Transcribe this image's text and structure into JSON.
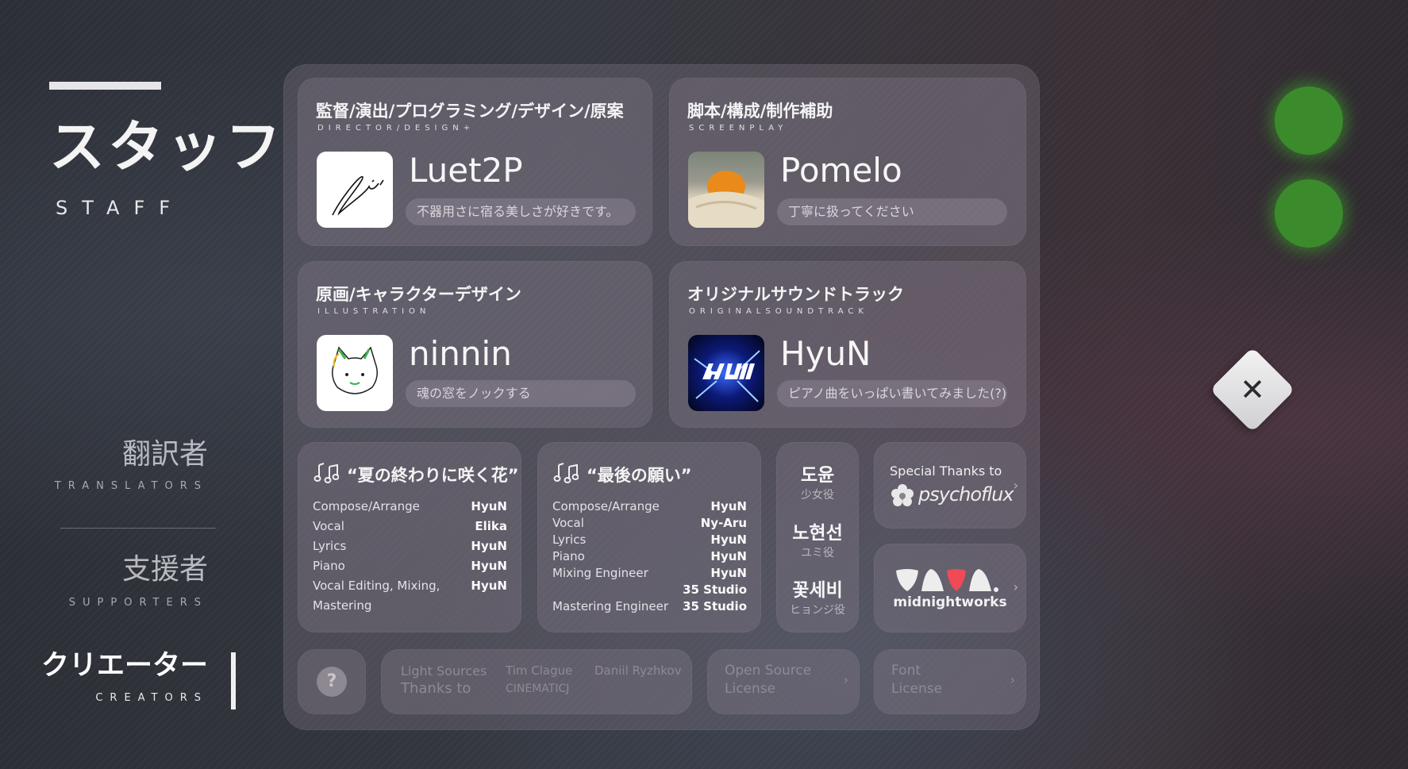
{
  "sidebar": {
    "title_ja": "スタッフ",
    "title_en": "STAFF",
    "items": [
      {
        "ja": "翻訳者",
        "en": "TRANSLATORS"
      },
      {
        "ja": "支援者",
        "en": "SUPPORTERS"
      },
      {
        "ja": "クリエーター",
        "en": "CREATORS",
        "active": true
      }
    ]
  },
  "staff": [
    {
      "role_ja": "監督/演出/プログラミング/デザイン/原案",
      "role_en": "DIRECTOR/DESIGN+",
      "name": "Luet2P",
      "quote": "不器用さに宿る美しさが好きです。"
    },
    {
      "role_ja": "脚本/構成/制作補助",
      "role_en": "SCREENPLAY",
      "name": "Pomelo",
      "quote": "丁寧に扱ってください"
    },
    {
      "role_ja": "原画/キャラクターデザイン",
      "role_en": "ILLUSTRATION",
      "name": "ninnin",
      "quote": "魂の窓をノックする"
    },
    {
      "role_ja": "オリジナルサウンドトラック",
      "role_en": "ORIGINALSOUNDTRACK",
      "name": "HyuN",
      "quote": "ピアノ曲をいっぱい書いてみました(?)"
    }
  ],
  "songs": [
    {
      "title": "“夏の終わりに咲く花”",
      "credits": [
        {
          "label": "Compose/Arrange",
          "value": "HyuN"
        },
        {
          "label": "Vocal",
          "value": "Elika"
        },
        {
          "label": "Lyrics",
          "value": "HyuN"
        },
        {
          "label": "Piano",
          "value": "HyuN"
        },
        {
          "label": "Vocal Editing, Mixing,",
          "value": "HyuN"
        },
        {
          "label": "Mastering",
          "value": ""
        }
      ]
    },
    {
      "title": "“最後の願い”",
      "credits": [
        {
          "label": "Compose/Arrange",
          "value": "HyuN"
        },
        {
          "label": "Vocal",
          "value": "Ny-Aru"
        },
        {
          "label": "Lyrics",
          "value": "HyuN"
        },
        {
          "label": "Piano",
          "value": "HyuN"
        },
        {
          "label": "Mixing Engineer",
          "value": "HyuN"
        },
        {
          "label": "",
          "value": "35 Studio"
        },
        {
          "label": "Mastering Engineer",
          "value": "35 Studio"
        }
      ]
    }
  ],
  "voice_actors": [
    {
      "name": "도윤",
      "role": "少女役"
    },
    {
      "name": "노현선",
      "role": "ユミ役"
    },
    {
      "name": "꽃세비",
      "role": "ヒョンジ役"
    }
  ],
  "special_thanks": {
    "label": "Special Thanks to",
    "logo_text": "psychoflux"
  },
  "midnightworks": {
    "label": "midnightworks"
  },
  "footer": {
    "help": "?",
    "light_sources": "Light Sources",
    "thanks_to": "Thanks to",
    "person1": "Tim Clague",
    "person1_sub": "CINEMATICJ",
    "person2": "Daniil Ryzhkov",
    "open_source_1": "Open Source",
    "open_source_2": "License",
    "font_1": "Font",
    "font_2": "License"
  },
  "controls": {
    "close": "✕"
  }
}
